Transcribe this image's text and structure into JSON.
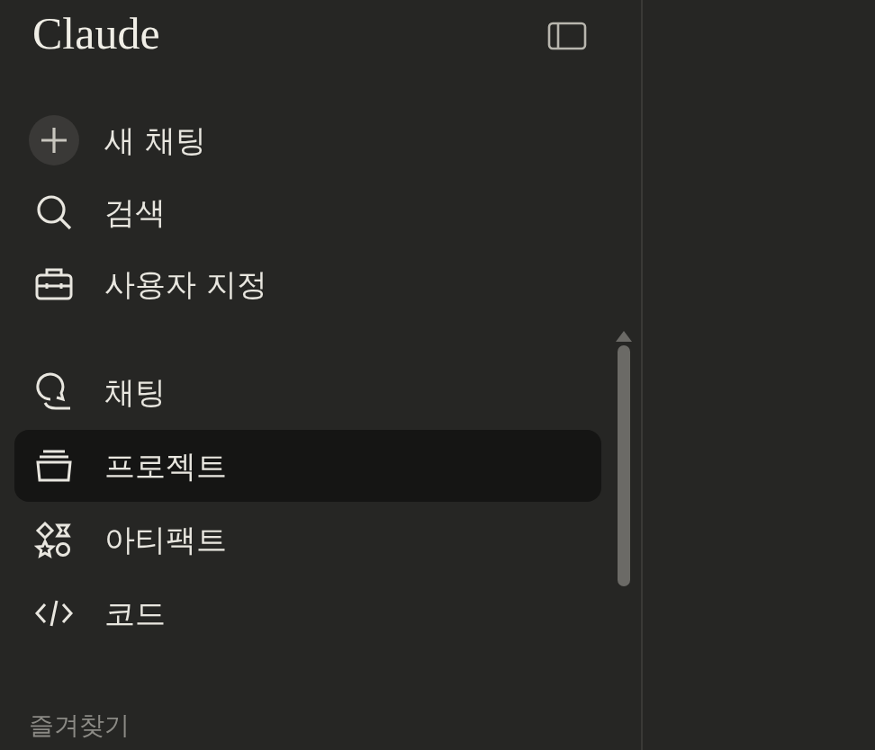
{
  "sidebar": {
    "title": "Claude",
    "top_items": [
      {
        "kind": "new",
        "label": "새 채팅",
        "selected": false
      },
      {
        "kind": "search",
        "label": "검색",
        "selected": false
      },
      {
        "kind": "customize",
        "label": "사용자 지정",
        "selected": false
      }
    ],
    "main_items": [
      {
        "kind": "chats",
        "label": "채팅",
        "selected": false
      },
      {
        "kind": "projects",
        "label": "프로젝트",
        "selected": true
      },
      {
        "kind": "artifacts",
        "label": "아티팩트",
        "selected": false
      },
      {
        "kind": "code",
        "label": "코드",
        "selected": false
      }
    ],
    "section_label": "즐겨찾기"
  }
}
